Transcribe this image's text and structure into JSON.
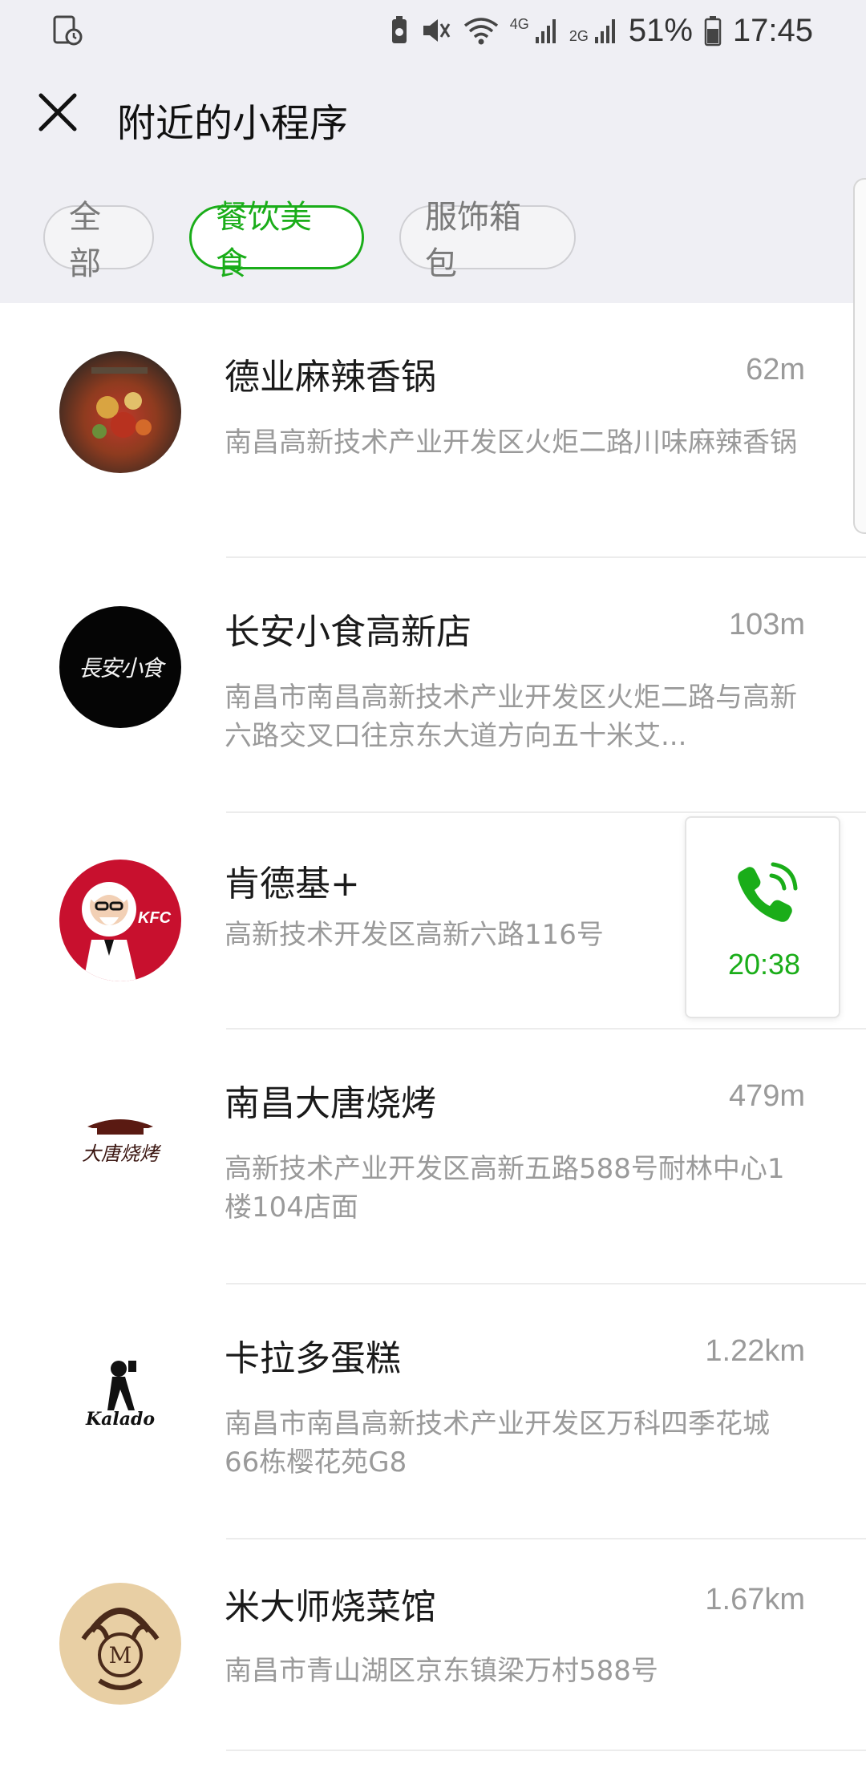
{
  "status_bar": {
    "battery": "51%",
    "time": "17:45",
    "net_4g": "4G",
    "net_2g": "2G"
  },
  "header": {
    "title": "附近的小程序"
  },
  "filters": {
    "all": "全部",
    "food": "餐饮美食",
    "clothes": "服饰箱包",
    "active": "food"
  },
  "items": [
    {
      "name": "德业麻辣香锅",
      "distance": "62m",
      "address": "南昌高新技术产业开发区火炬二路川味麻辣香锅",
      "icon": "spicy-pot-dish-icon"
    },
    {
      "name": "长安小食高新店",
      "distance": "103m",
      "address": "南昌市南昌高新技术产业开发区火炬二路与高新六路交叉口往京东大道方向五十米艾...",
      "icon": "changan-calligraphy-logo",
      "logo_text": "長安小食"
    },
    {
      "name": "肯德基+",
      "distance": "",
      "address": "高新技术开发区高新六路116号",
      "icon": "kfc-logo",
      "logo_text": "KFC"
    },
    {
      "name": "南昌大唐烧烤",
      "distance": "479m",
      "address": "高新技术产业开发区高新五路588号耐林中心1楼104店面",
      "icon": "datang-bbq-logo",
      "logo_text": "大唐烧烤"
    },
    {
      "name": "卡拉多蛋糕",
      "distance": "1.22km",
      "address": "南昌市南昌高新技术产业开发区万科四季花城66栋樱花苑G8",
      "icon": "kalado-logo",
      "logo_text": "Kalado"
    },
    {
      "name": "米大师烧菜馆",
      "distance": "1.67km",
      "address": "南昌市青山湖区京东镇梁万村588号",
      "icon": "mi-dashi-ornament-logo",
      "logo_text": "M"
    }
  ],
  "call_widget": {
    "duration": "20:38",
    "color": "#1aad19"
  },
  "colors": {
    "accent": "#1aad19",
    "header_bg": "#efeff4",
    "secondary_text": "#9a9a9a"
  }
}
